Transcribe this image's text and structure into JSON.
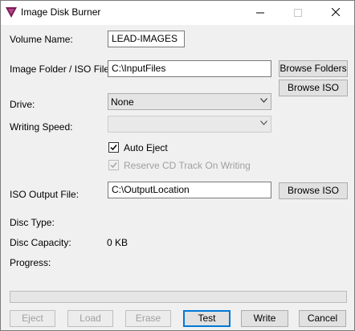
{
  "window": {
    "title": "Image Disk Burner",
    "controls": {
      "minimize": "—",
      "maximize": "☐",
      "close": "✕"
    }
  },
  "form": {
    "volume_name_label": "Volume Name:",
    "volume_name_value": "LEAD-IMAGES",
    "image_folder_label": "Image Folder / ISO File:",
    "image_folder_value": "C:\\InputFiles",
    "browse_folders_label": "Browse Folders",
    "browse_iso_label": "Browse ISO",
    "drive_label": "Drive:",
    "drive_value": "None",
    "writing_speed_label": "Writing Speed:",
    "writing_speed_value": "",
    "auto_eject_label": "Auto Eject",
    "auto_eject_checked": true,
    "reserve_cd_label": "Reserve CD Track On Writing",
    "reserve_cd_checked": true,
    "reserve_cd_enabled": false,
    "iso_output_label": "ISO Output File:",
    "iso_output_value": "C:\\OutputLocation",
    "browse_iso_output_label": "Browse ISO"
  },
  "info": {
    "disc_type_label": "Disc Type:",
    "disc_type_value": "",
    "disc_capacity_label": "Disc Capacity:",
    "disc_capacity_value": "0 KB",
    "progress_label": "Progress:",
    "progress_fraction": 0
  },
  "buttons": {
    "eject": "Eject",
    "load": "Load",
    "erase": "Erase",
    "test": "Test",
    "write": "Write",
    "cancel": "Cancel"
  },
  "colors": {
    "icon_triangle": "#7a1a52",
    "focus_border": "#0078d7",
    "progress_fill": "#06b025"
  }
}
